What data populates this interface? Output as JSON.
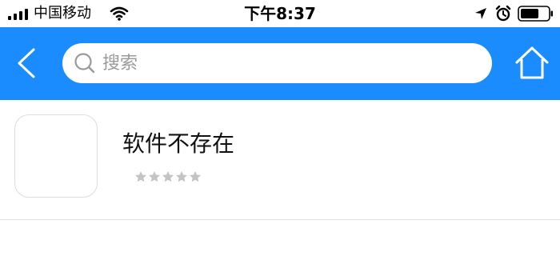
{
  "status_bar": {
    "carrier": "中国移动",
    "time": "下午8:37",
    "icons": [
      "signal-icon",
      "wifi-icon",
      "location-icon",
      "alarm-icon",
      "battery-icon"
    ]
  },
  "colors": {
    "nav_background": "#1a8cfe",
    "star_gray": "#c4c4c4"
  },
  "nav": {
    "back_icon": "back-chevron-icon",
    "search_placeholder": "搜索",
    "search_value": "",
    "home_icon": "home-icon"
  },
  "app": {
    "name": "软件不存在",
    "rating": {
      "value": 0,
      "max": 5
    }
  }
}
